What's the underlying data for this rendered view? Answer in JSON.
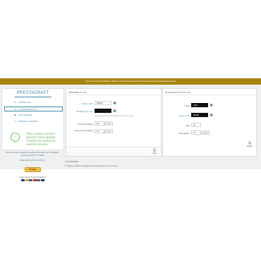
{
  "banner": {
    "message": "You are running Ventidevno. Please note that all settings will be saved by unmodal standard step."
  },
  "sidebar": {
    "logo": "PRESTACRAFT",
    "items": [
      {
        "icon": "✉",
        "label": "MARKETING",
        "active": false
      },
      {
        "icon": "⚙",
        "label": "CONFIGURATION",
        "active": true
      },
      {
        "icon": "▣",
        "label": "OUR ADDONS",
        "active": false
      },
      {
        "icon": "↻",
        "label": "MODULE UPDATES",
        "active": false
      }
    ],
    "status_message": "This module version doesn't need update. Thanks for using the newest version",
    "notes": {
      "line1": "Have a look at my blog with tutorials and modules for Prestashop:",
      "link": "www.prestacraft.com",
      "line1_tail": "Thanks",
      "line2_prefix": "Made with",
      "line2_suffix": "by",
      "line2_link": "Prestacraft.com"
    },
    "donate_label": "Donate",
    "support_text": "Create Support Prestacraft Modules"
  },
  "panel_left": {
    "title": "WRAPPER STYLE",
    "fields": [
      {
        "label": "Popup color",
        "value": "#ebf9f0",
        "highlight": true,
        "type": "color"
      },
      {
        "label": "Background color",
        "value": "#000000",
        "highlight": true,
        "type": "color-dark"
      }
    ],
    "hint": "Leave empty to use the transparent background color",
    "paddings": [
      {
        "label": "Content padding",
        "value": "20",
        "unit": "pixels"
      },
      {
        "label": "Content top padding",
        "value": "40",
        "unit": "pixels"
      }
    ],
    "save_label": "Save"
  },
  "panel_right": {
    "title": "BLOCKS BUTTON STYLE",
    "fields": [
      {
        "label": "Color",
        "value": "white",
        "highlight": false,
        "type": "color-dark"
      },
      {
        "label": "Hover color",
        "value": "#f4f4f4",
        "highlight": true,
        "type": "color-dark"
      }
    ],
    "sizes": [
      {
        "label": "Size",
        "value": "20",
        "unit": ""
      },
      {
        "label": "Top padding",
        "value": "15",
        "unit": "pixels"
      }
    ],
    "save_label": "Migrate"
  },
  "keywords": {
    "title": "KEYWORDS",
    "line": "Shipping, Ostatní, Remapper, Kontakt, Stranky. EN: 1.2.3 Free"
  },
  "colors": {
    "banner": "#a8850f",
    "accent": "#3b8aa6",
    "success": "#6dbf63"
  }
}
